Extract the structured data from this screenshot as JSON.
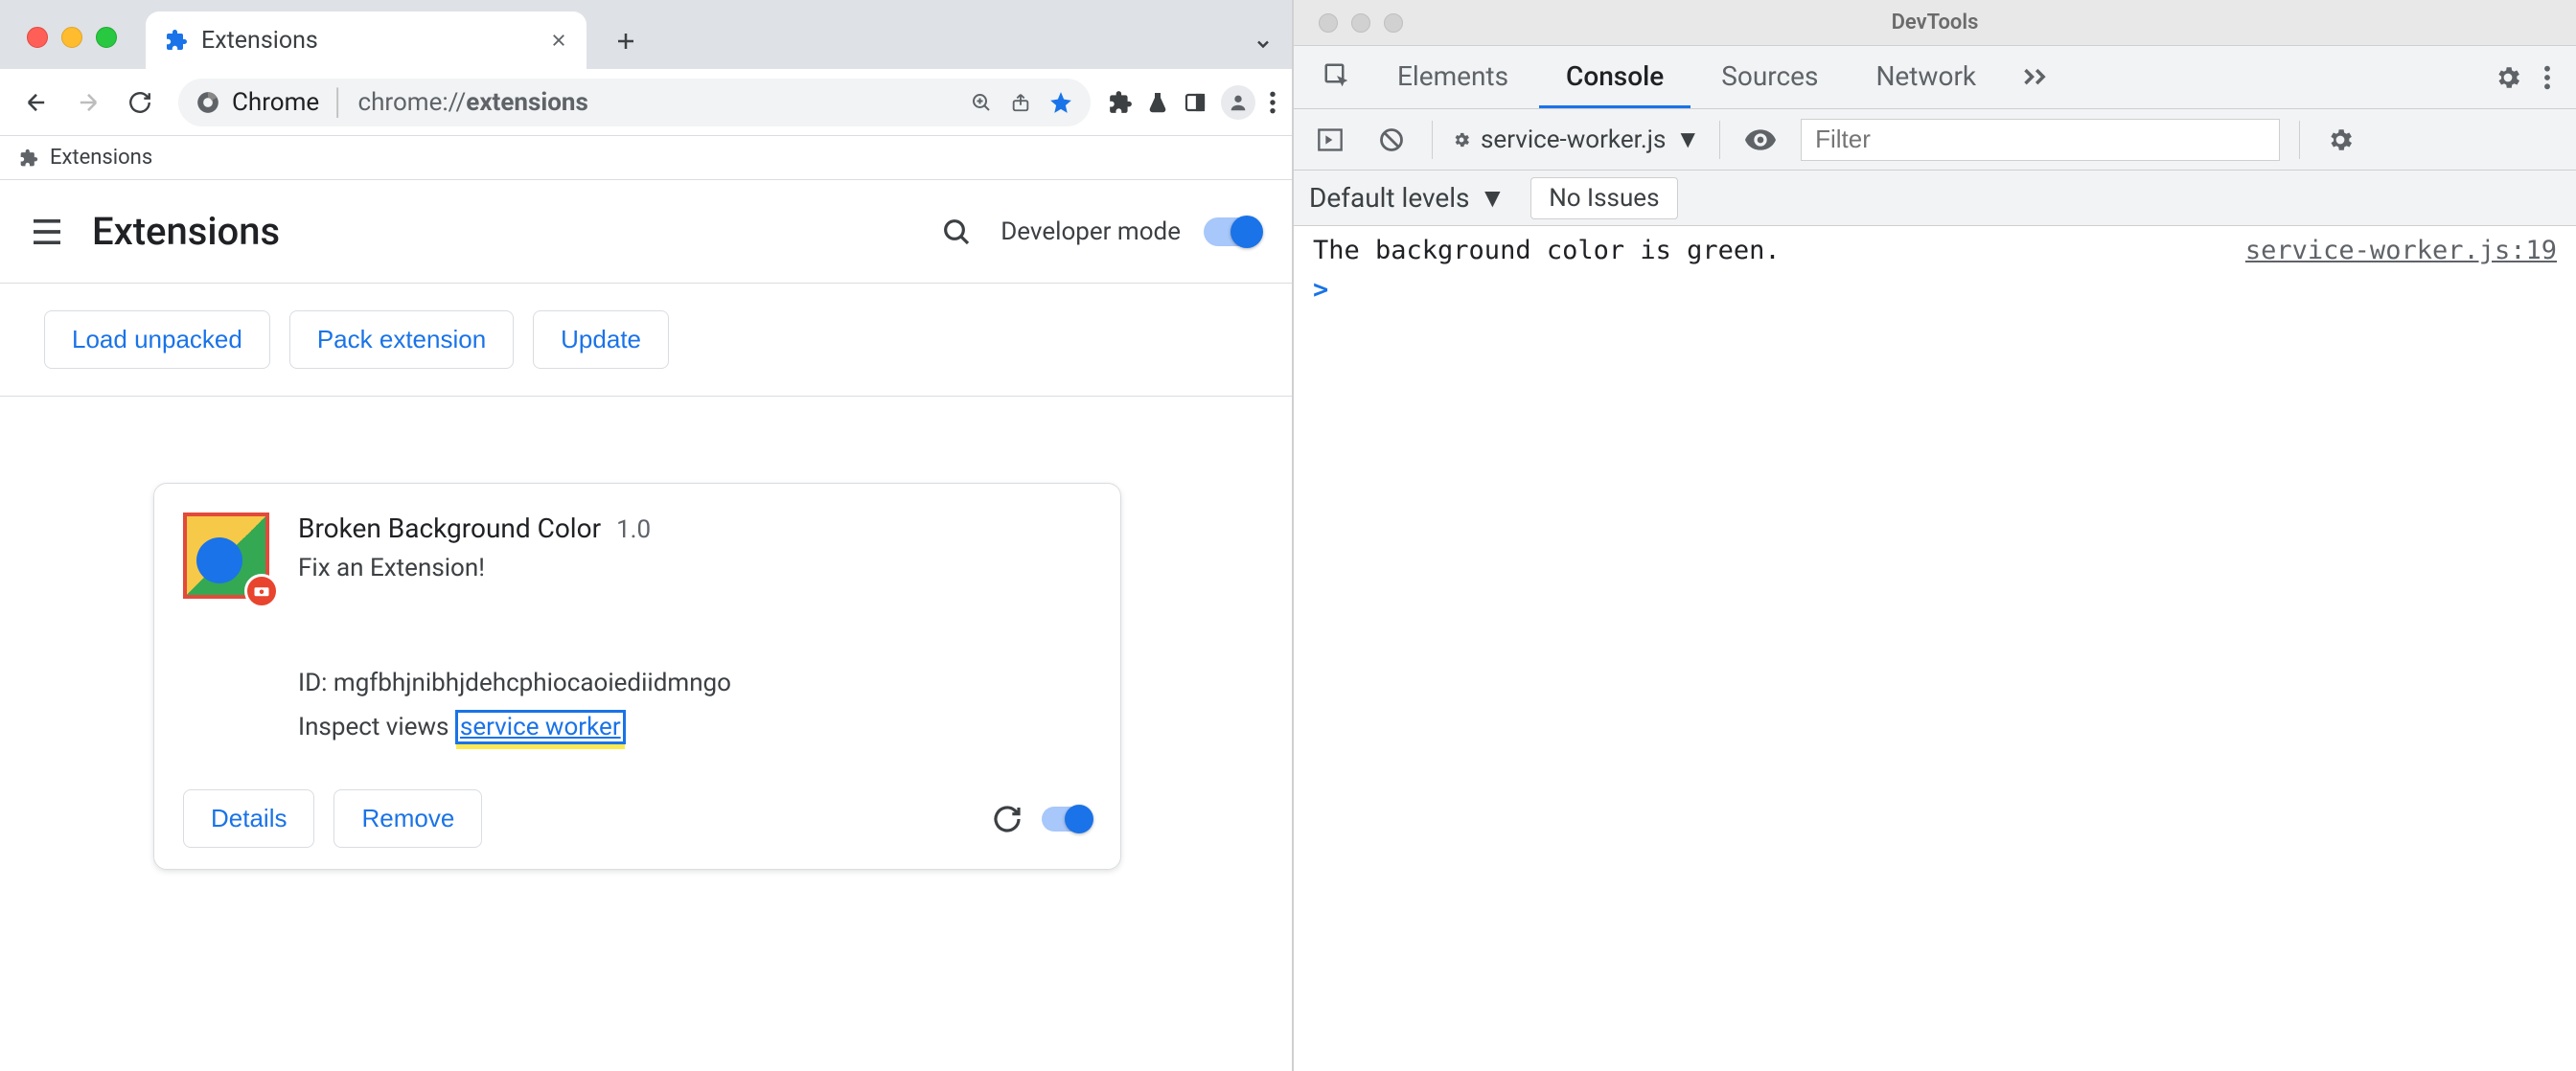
{
  "chrome": {
    "tab": {
      "title": "Extensions"
    },
    "omnibox": {
      "origin": "Chrome",
      "path_prefix": "chrome://",
      "path_bold": "extensions"
    },
    "bookmark": {
      "label": "Extensions"
    },
    "page": {
      "title": "Extensions",
      "dev_mode_label": "Developer mode",
      "actions": {
        "load_unpacked": "Load unpacked",
        "pack": "Pack extension",
        "update": "Update"
      },
      "card": {
        "name": "Broken Background Color",
        "version": "1.0",
        "description": "Fix an Extension!",
        "id_label": "ID:",
        "id_value": "mgfbhjnibhjdehcphiocaoiediidmngo",
        "inspect_label": "Inspect views",
        "inspect_link": "service worker",
        "details": "Details",
        "remove": "Remove"
      }
    }
  },
  "devtools": {
    "title": "DevTools",
    "tabs": {
      "elements": "Elements",
      "console": "Console",
      "sources": "Sources",
      "network": "Network"
    },
    "subbar": {
      "context": "service-worker.js",
      "filter_placeholder": "Filter"
    },
    "subbar2": {
      "levels": "Default levels",
      "issues": "No Issues"
    },
    "console": {
      "message": "The background color is green.",
      "source": "service-worker.js:19",
      "prompt": ">"
    }
  }
}
